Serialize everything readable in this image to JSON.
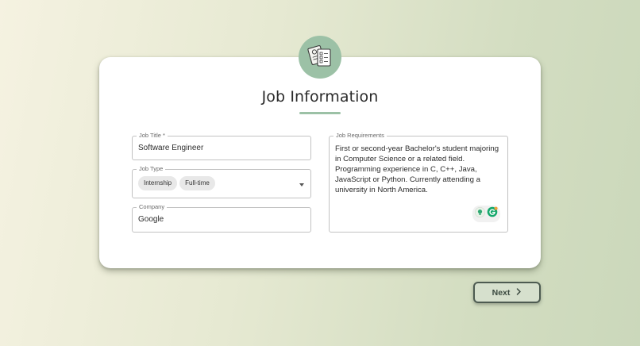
{
  "header": {
    "icon": "documents-icon",
    "title": "Job Information"
  },
  "form": {
    "job_title": {
      "label": "Job Title *",
      "value": "Software Engineer"
    },
    "job_type": {
      "label": "Job Type",
      "chips": [
        "Internship",
        "Full-time"
      ]
    },
    "company": {
      "label": "Company",
      "value": "Google"
    },
    "job_requirements": {
      "label": "Job Requirements",
      "value": "First or second-year Bachelor's student majoring in Computer Science or a related field. Programming experience in C, C++, Java, JavaScript or Python. Currently attending a university in North America."
    }
  },
  "actions": {
    "next_label": "Next"
  },
  "colors": {
    "accent": "#9cc1a6",
    "button_border": "#4d5b51",
    "button_bg": "#d6e0cd"
  }
}
